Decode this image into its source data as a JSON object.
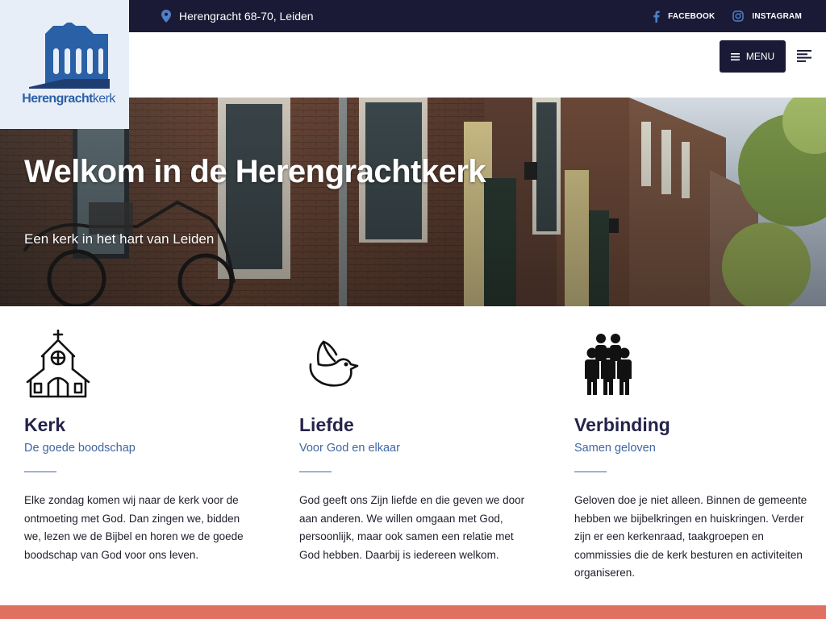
{
  "topbar": {
    "address": "Herengracht 68-70, Leiden",
    "facebook_label": "FACEBOOK",
    "instagram_label": "INSTAGRAM"
  },
  "logo": {
    "text_bold": "Herengracht",
    "text_regular": "kerk"
  },
  "nav": {
    "menu_label": "MENU"
  },
  "hero": {
    "title": "Welkom in de Herengrachtkerk",
    "subtitle": "Een kerk in het hart van Leiden"
  },
  "features": [
    {
      "icon": "church-icon",
      "title": "Kerk",
      "subtitle": "De goede boodschap",
      "body": "Elke zondag komen wij naar de kerk voor de ontmoeting met God. Dan zingen we, bidden we, lezen we de Bijbel en horen we de goede boodschap van God voor ons leven."
    },
    {
      "icon": "dove-icon",
      "title": "Liefde",
      "subtitle": "Voor God en elkaar",
      "body": "God geeft ons Zijn liefde en die geven we door aan anderen. We willen omgaan met God, persoonlijk, maar ook samen een relatie met God hebben. Daarbij is iedereen welkom."
    },
    {
      "icon": "people-group-icon",
      "title": "Verbinding",
      "subtitle": "Samen geloven",
      "body": "Geloven doe je niet alleen. Binnen de gemeente hebben we bijbelkringen en huiskringen. Verder zijn er een kerkenraad, taakgroepen en commissies die de kerk besturen en activiteiten organiseren."
    }
  ],
  "colors": {
    "navy": "#1b1a36",
    "accent_blue": "#3f67a3",
    "logo_blue": "#2a60a6",
    "coral": "#e07060"
  }
}
